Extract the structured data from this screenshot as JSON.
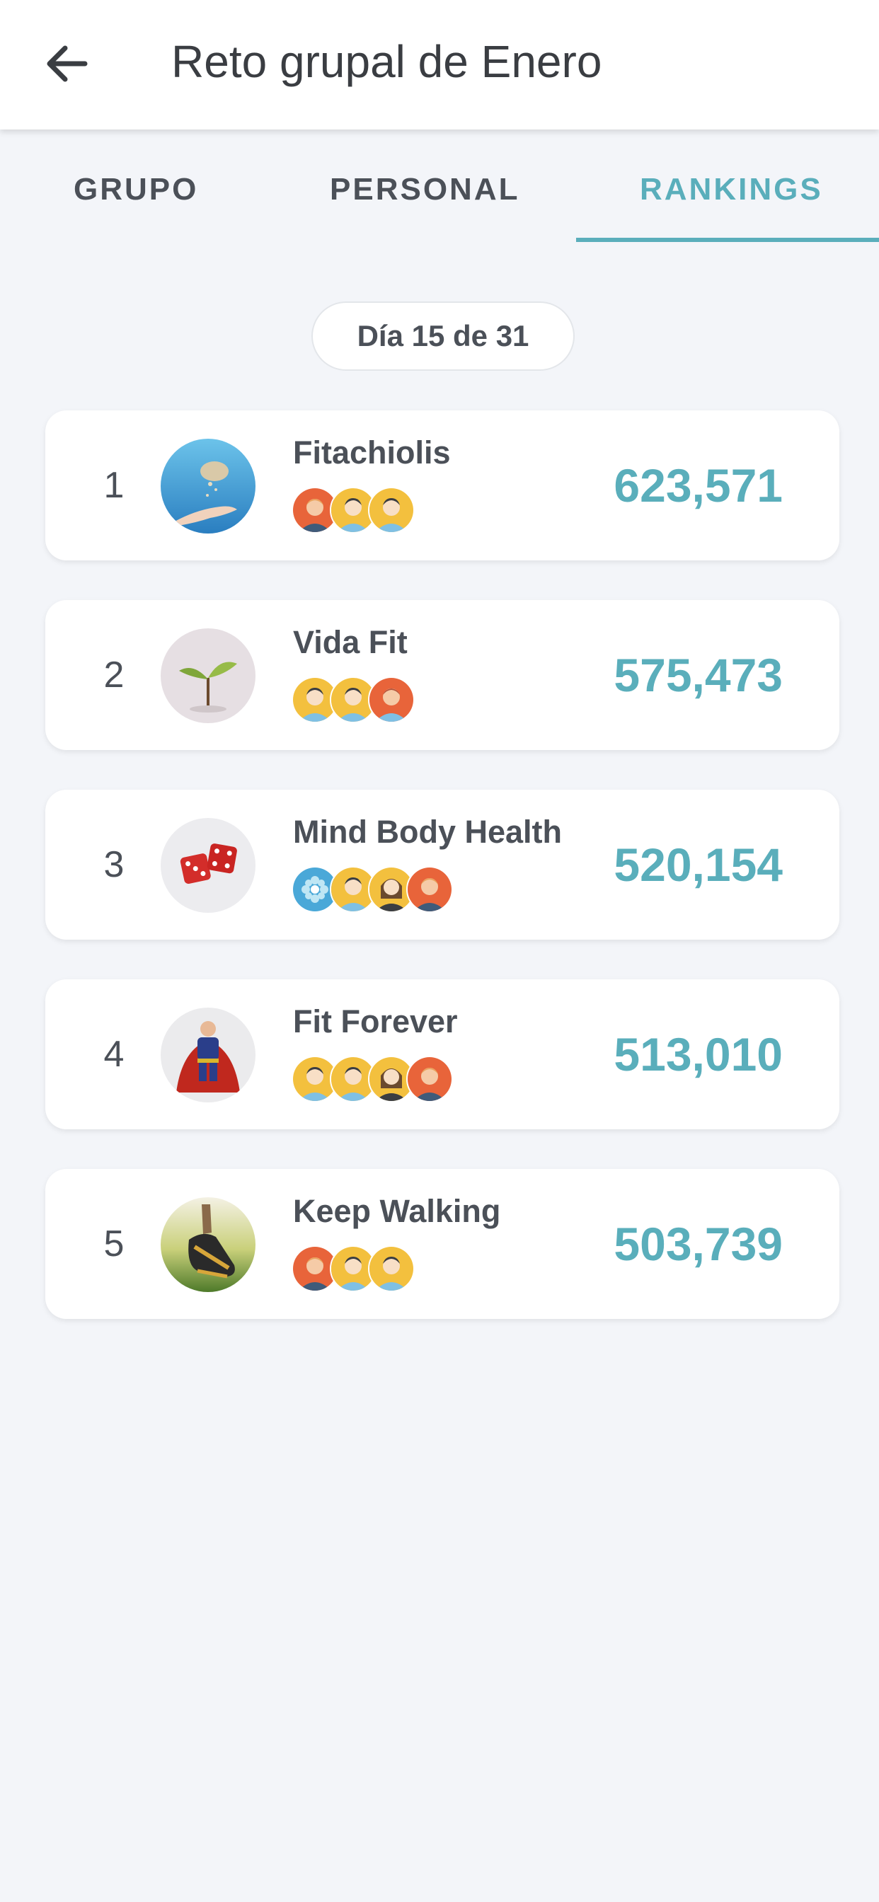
{
  "header": {
    "title": "Reto grupal de Enero"
  },
  "tabs": [
    {
      "label": "GRUPO",
      "active": false
    },
    {
      "label": "PERSONAL",
      "active": false
    },
    {
      "label": "RANKINGS",
      "active": true
    }
  ],
  "day_pill": "Día 15 de 31",
  "colors": {
    "accent": "#5aaebb",
    "text": "#4b5058",
    "background": "#f3f5f9"
  },
  "rankings": [
    {
      "rank": "1",
      "name": "Fitachiolis",
      "score": "623,571",
      "avatar": "hand-sand-photo",
      "members": [
        "orange-avatar",
        "yellow-avatar",
        "yellow-avatar"
      ]
    },
    {
      "rank": "2",
      "name": "Vida Fit",
      "score": "575,473",
      "avatar": "sprout-photo",
      "members": [
        "yellow-avatar",
        "yellow-avatar",
        "orange-avatar"
      ]
    },
    {
      "rank": "3",
      "name": "Mind Body Health",
      "score": "520,154",
      "avatar": "dice-photo",
      "members": [
        "teal-flower-avatar",
        "yellow-avatar",
        "yellow-woman-avatar",
        "orange-avatar"
      ]
    },
    {
      "rank": "4",
      "name": "Fit Forever",
      "score": "513,010",
      "avatar": "superman-photo",
      "members": [
        "yellow-avatar",
        "yellow-avatar",
        "yellow-woman-avatar",
        "orange-avatar"
      ]
    },
    {
      "rank": "5",
      "name": "Keep Walking",
      "score": "503,739",
      "avatar": "sneaker-photo",
      "members": [
        "orange-avatar",
        "yellow-avatar",
        "yellow-avatar"
      ]
    }
  ]
}
